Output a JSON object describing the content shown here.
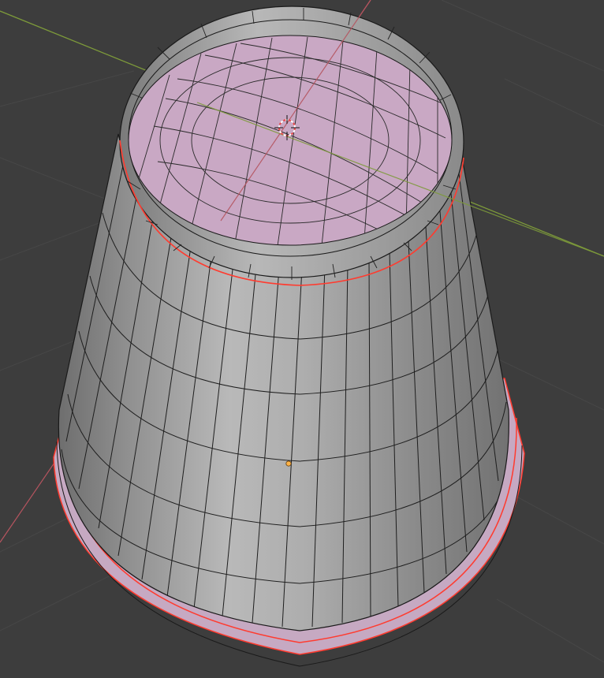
{
  "viewport": {
    "view": "3d-viewport",
    "mode": "edit-mode",
    "shading": "solid",
    "object": "cup-mesh"
  },
  "colors": {
    "background": "#3d3d3d",
    "grid_line": "#4a4a4a",
    "x_axis": "#b5545f",
    "y_axis": "#7d9a3a",
    "mesh_face": "#a9a9a9",
    "mesh_edge": "#1a1a1a",
    "selected_face": "#c9a8c4",
    "selected_edge": "#ff3b2f",
    "origin_dot": "#ffb347",
    "cursor_red": "#e84a4a"
  },
  "icons": [
    "3d-cursor-icon",
    "object-origin-icon"
  ]
}
